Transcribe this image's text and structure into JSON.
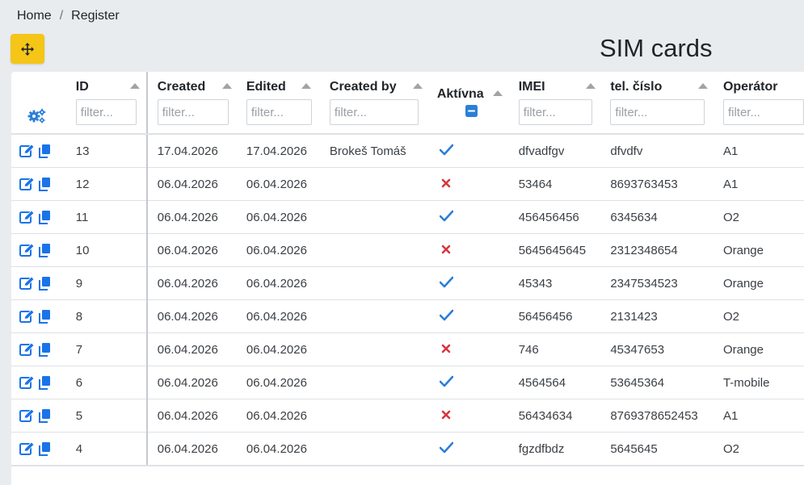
{
  "breadcrumb": {
    "home": "Home",
    "separator": "/",
    "current": "Register"
  },
  "page": {
    "title": "SIM cards"
  },
  "colors": {
    "accent": "#f5c518",
    "link": "#1a73e8",
    "check": "#2a7fd6",
    "cross": "#d9363e"
  },
  "table": {
    "columns": {
      "id": "ID",
      "created": "Created",
      "edited": "Edited",
      "created_by": "Created by",
      "active": "Aktívna",
      "imei": "IMEI",
      "phone": "tel. číslo",
      "operator": "Operátor"
    },
    "filter_placeholder": "filter...",
    "rows": [
      {
        "id": "13",
        "created": "17.04.2026",
        "edited": "17.04.2026",
        "created_by": "Brokeš Tomáš",
        "active": true,
        "imei": "dfvadfgv",
        "phone": "dfvdfv",
        "operator": "A1"
      },
      {
        "id": "12",
        "created": "06.04.2026",
        "edited": "06.04.2026",
        "created_by": "",
        "active": false,
        "imei": "53464",
        "phone": "8693763453",
        "operator": "A1"
      },
      {
        "id": "11",
        "created": "06.04.2026",
        "edited": "06.04.2026",
        "created_by": "",
        "active": true,
        "imei": "456456456",
        "phone": "6345634",
        "operator": "O2"
      },
      {
        "id": "10",
        "created": "06.04.2026",
        "edited": "06.04.2026",
        "created_by": "",
        "active": false,
        "imei": "5645645645",
        "phone": "2312348654",
        "operator": "Orange"
      },
      {
        "id": "9",
        "created": "06.04.2026",
        "edited": "06.04.2026",
        "created_by": "",
        "active": true,
        "imei": "45343",
        "phone": "2347534523",
        "operator": "Orange"
      },
      {
        "id": "8",
        "created": "06.04.2026",
        "edited": "06.04.2026",
        "created_by": "",
        "active": true,
        "imei": "56456456",
        "phone": "2131423",
        "operator": "O2"
      },
      {
        "id": "7",
        "created": "06.04.2026",
        "edited": "06.04.2026",
        "created_by": "",
        "active": false,
        "imei": "746",
        "phone": "45347653",
        "operator": "Orange"
      },
      {
        "id": "6",
        "created": "06.04.2026",
        "edited": "06.04.2026",
        "created_by": "",
        "active": true,
        "imei": "4564564",
        "phone": "53645364",
        "operator": "T-mobile"
      },
      {
        "id": "5",
        "created": "06.04.2026",
        "edited": "06.04.2026",
        "created_by": "",
        "active": false,
        "imei": "56434634",
        "phone": "8769378652453",
        "operator": "A1"
      },
      {
        "id": "4",
        "created": "06.04.2026",
        "edited": "06.04.2026",
        "created_by": "",
        "active": true,
        "imei": "fgzdfbdz",
        "phone": "5645645",
        "operator": "O2"
      }
    ]
  }
}
